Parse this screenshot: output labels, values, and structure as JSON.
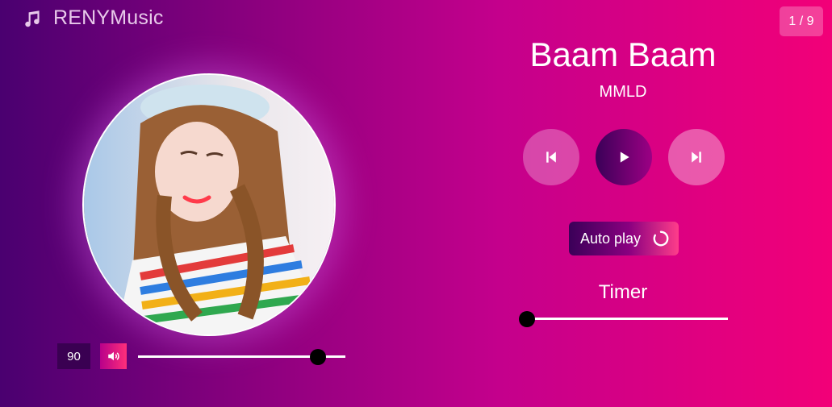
{
  "app": {
    "name": "RENYMusic",
    "icon": "music-note-icon"
  },
  "playlist": {
    "position_text": "1 / 9",
    "current_index": 1,
    "total": 9
  },
  "track": {
    "title": "Baam Baam",
    "artist": "MMLD",
    "cover_image": "album-art-portrait"
  },
  "controls": {
    "prev_icon": "skip-previous-icon",
    "play_icon": "play-icon",
    "next_icon": "skip-next-icon"
  },
  "autoplay": {
    "label": "Auto play",
    "icon": "loop-icon"
  },
  "volume": {
    "value_text": "90",
    "level": 0.9,
    "icon": "speaker-icon"
  },
  "timer": {
    "label": "Timer",
    "level": 0.0
  },
  "colors": {
    "gradient_start": "#4a0070",
    "gradient_end": "#f20078",
    "thumb": "#000000",
    "track": "#ffffff"
  }
}
